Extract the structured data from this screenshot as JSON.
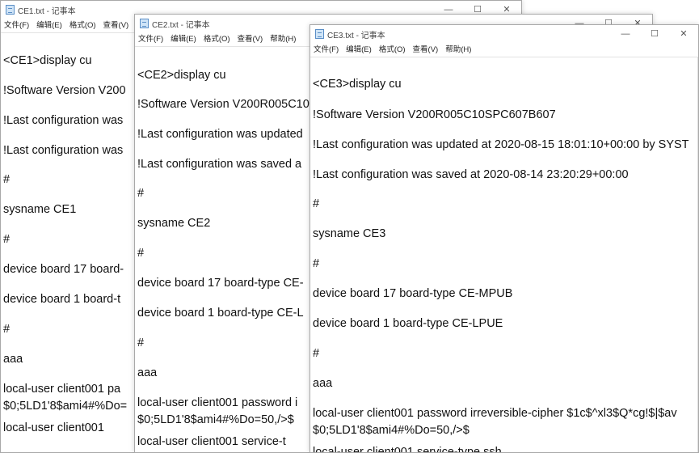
{
  "windows": [
    {
      "title": "CE1.txt - 记事本",
      "menu": [
        "文件(F)",
        "编辑(E)",
        "格式(O)",
        "查看(V)"
      ],
      "lines": [
        "<CE1>display cu",
        "!Software Version V200",
        "!Last configuration was",
        "!Last configuration was",
        "#",
        "sysname CE1",
        "#",
        "device board 17 board-",
        "device board 1 board-t",
        "#",
        "aaa",
        " local-user client001 pa",
        "$0;5LD1'8$ami4#%Do=",
        " local-user client001"
      ]
    },
    {
      "title": "CE2.txt - 记事本",
      "menu": [
        "文件(F)",
        "编辑(E)",
        "格式(O)",
        "查看(V)",
        "帮助(H)"
      ],
      "lines": [
        "<CE2>display cu",
        "!Software Version V200R005C10",
        "!Last configuration was updated",
        "!Last configuration was saved a",
        "#",
        "sysname CE2",
        "#",
        "device board 17 board-type CE-",
        "device board 1 board-type CE-L",
        "#",
        "aaa",
        " local-user client001 password i",
        "$0;5LD1'8$ami4#%Do=50,/>$",
        " local-user client001 service-t"
      ]
    },
    {
      "title": "CE3.txt - 记事本",
      "menu": [
        "文件(F)",
        "编辑(E)",
        "格式(O)",
        "查看(V)",
        "帮助(H)"
      ],
      "lines": [
        "<CE3>display cu",
        "!Software Version V200R005C10SPC607B607",
        "!Last configuration was updated at 2020-08-15 18:01:10+00:00 by SYST",
        "!Last configuration was saved at 2020-08-14 23:20:29+00:00",
        "#",
        "sysname CE3",
        "#",
        "device board 17 board-type CE-MPUB",
        "device board 1 board-type CE-LPUE",
        "#",
        "aaa",
        " local-user client001 password irreversible-cipher $1c$^xl3$Q*cg!$|$av",
        "$0;5LD1'8$ami4#%Do=50,/>$",
        " local-user client001 service-type ssh"
      ]
    }
  ],
  "window_controls": {
    "minimize": "—",
    "maximize": "☐",
    "close": "✕"
  }
}
